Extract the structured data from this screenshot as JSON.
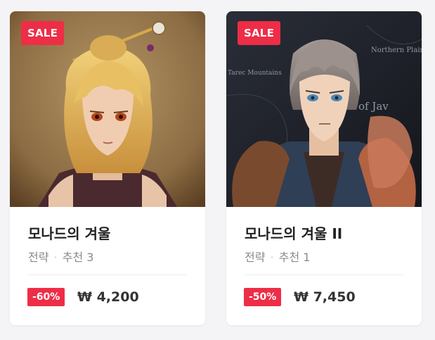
{
  "products": [
    {
      "badge": "SALE",
      "title": "모나드의 겨울",
      "genre": "전략",
      "recommend": "추천 3",
      "discount": "-60%",
      "price": "₩ 4,200"
    },
    {
      "badge": "SALE",
      "title": "모나드의 겨울 II",
      "genre": "전략",
      "recommend": "추천 1",
      "discount": "-50%",
      "price": "₩ 7,450",
      "map_labels": [
        "Northern Plain",
        "Tarec Mountains",
        "of Jav"
      ]
    }
  ],
  "colors": {
    "sale_red": "#ee2d46",
    "bg": "#f4f4f6"
  }
}
